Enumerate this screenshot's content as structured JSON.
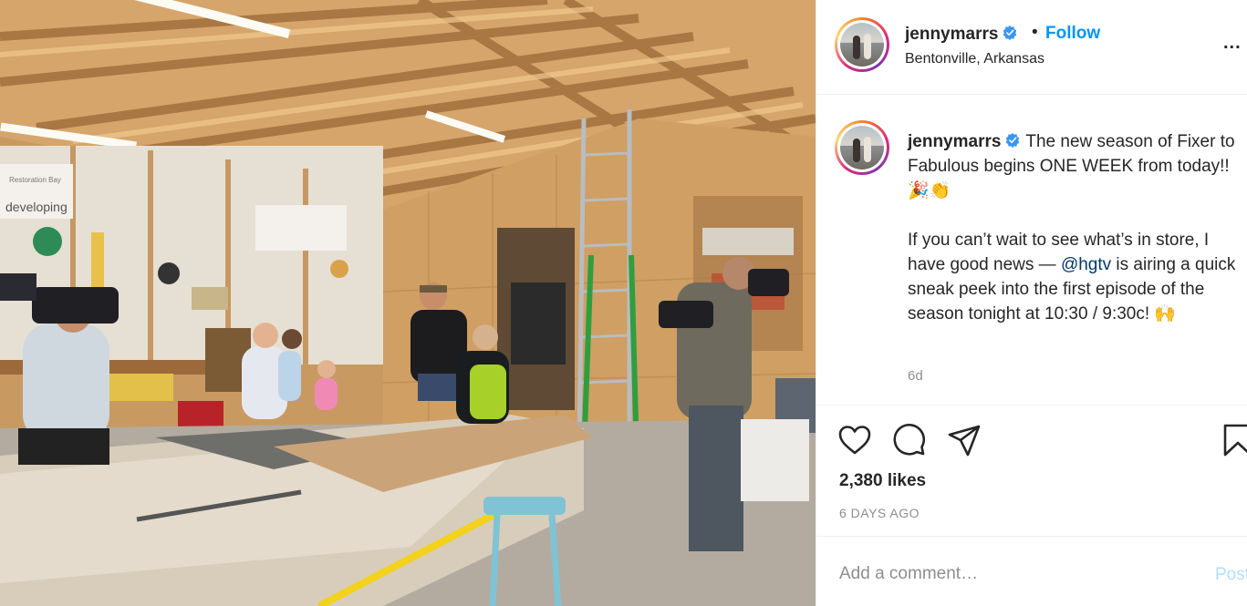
{
  "header": {
    "username": "jennymarrs",
    "follow_label": "Follow",
    "separator": "•",
    "location": "Bentonville, Arkansas",
    "more_label": "..."
  },
  "photo": {
    "sign_text": "developing",
    "sign_subtext": "Restoration Bay"
  },
  "caption": {
    "username": "jennymarrs",
    "text_before_mention": " The new season of Fixer to Fabulous begins ONE WEEK from today!! 🎉👏\n\nIf you can’t wait to see what’s in store, I have good news — ",
    "mention": "@hgtv",
    "text_after_mention": " is airing a quick sneak peek into the first episode of the season tonight at 10:30 / 9:30c! 🙌",
    "time_ago": "6d"
  },
  "actions": {
    "like_icon": "heart-icon",
    "comment_icon": "comment-icon",
    "share_icon": "share-icon",
    "save_icon": "bookmark-icon",
    "likes_text": "2,380 likes",
    "date_text": "6 DAYS AGO"
  },
  "comment": {
    "placeholder": "Add a comment…",
    "post_label": "Post"
  },
  "colors": {
    "follow_blue": "#0095f6",
    "verified_blue": "#3897f0",
    "mention_blue": "#00376b",
    "post_disabled": "#b2dffc",
    "muted_gray": "#8e8e8e"
  }
}
